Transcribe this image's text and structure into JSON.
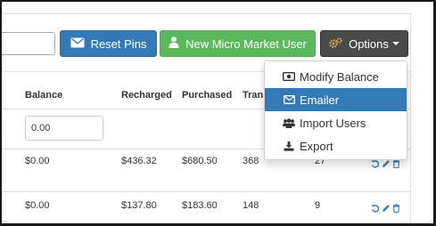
{
  "toolbar": {
    "search_value": "",
    "reset_pins_label": "Reset Pins",
    "new_user_label": "New Micro Market User",
    "options_label": "Options"
  },
  "options_menu": {
    "items": [
      {
        "label": "Modify Balance",
        "icon": "money-icon",
        "active": false
      },
      {
        "label": "Emailer",
        "icon": "envelope-icon",
        "active": true
      },
      {
        "label": "Import Users",
        "icon": "users-icon",
        "active": false
      },
      {
        "label": "Export",
        "icon": "download-icon",
        "active": false
      }
    ]
  },
  "table": {
    "headers": [
      "Balance",
      "Recharged",
      "Purchased",
      "Tran"
    ],
    "filter_balance_value": "0.00",
    "rows": [
      {
        "balance": "$0.00",
        "recharged": "$436.32",
        "purchased": "$680.50",
        "transactions": "368",
        "extra": "27"
      },
      {
        "balance": "$0.00",
        "recharged": "$137.80",
        "purchased": "$183.60",
        "transactions": "148",
        "extra": "9"
      }
    ]
  },
  "colors": {
    "primary": "#337ab7",
    "success": "#5cb85c",
    "dark": "#4a4a4a",
    "link": "#337ab7"
  }
}
